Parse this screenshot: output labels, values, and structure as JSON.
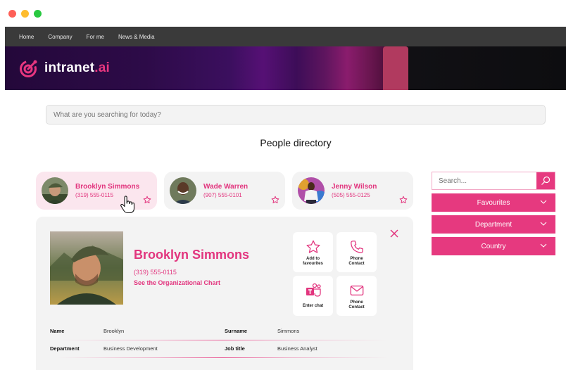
{
  "window": {
    "controls": [
      "close",
      "minimize",
      "maximize"
    ]
  },
  "nav": {
    "items": [
      "Home",
      "Company",
      "For me",
      "News & Media"
    ]
  },
  "brand": {
    "name": "intranet",
    "suffix": ".ai",
    "accent": "#e8367f"
  },
  "search": {
    "placeholder": "What are you searching for today?"
  },
  "page": {
    "title": "People directory"
  },
  "people": [
    {
      "name": "Brooklyn Simmons",
      "phone": "(319) 555-0115",
      "active": true
    },
    {
      "name": "Wade Warren",
      "phone": "(907) 555-0101",
      "active": false
    },
    {
      "name": "Jenny Wilson",
      "phone": "(505) 555-0125",
      "active": false
    }
  ],
  "filters": {
    "search_placeholder": "Search...",
    "dropdowns": [
      "Favourites",
      "Department",
      "Country"
    ]
  },
  "detail": {
    "name": "Brooklyn Simmons",
    "phone": "(319) 555-0115",
    "org_link": "See the Organizational Chart",
    "actions": [
      {
        "icon": "star-icon",
        "label_1": "Add to",
        "label_2": "favourites"
      },
      {
        "icon": "phone-icon",
        "label_1": "Phone",
        "label_2": "Contact"
      },
      {
        "icon": "teams-icon",
        "label_1": "Enter chat",
        "label_2": ""
      },
      {
        "icon": "mail-icon",
        "label_1": "Phone",
        "label_2": "Contact"
      }
    ],
    "fields": [
      {
        "k1": "Name",
        "v1": "Brooklyn",
        "k2": "Surname",
        "v2": "Simmons"
      },
      {
        "k1": "Department",
        "v1": "Business Development",
        "k2": "Job title",
        "v2": "Business Analyst"
      }
    ]
  }
}
